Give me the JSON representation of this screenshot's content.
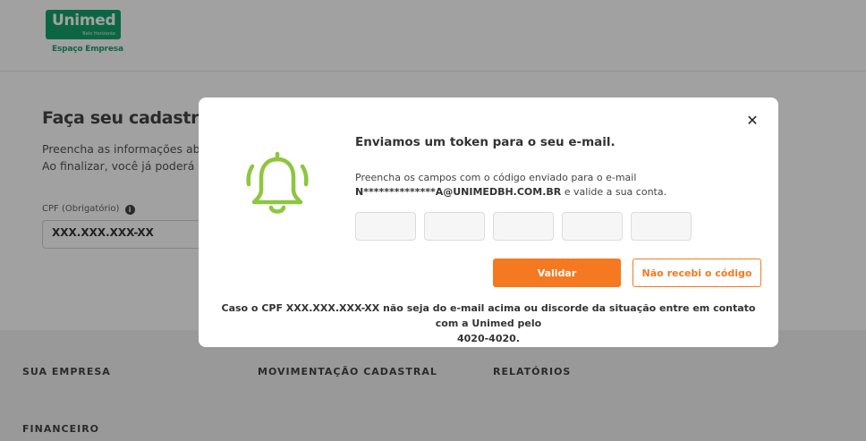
{
  "header": {
    "logo_text": "Unimed",
    "logo_subtext": "Belo Horizonte",
    "portal_name": "Espaço Empresa"
  },
  "page": {
    "title": "Faça seu cadastro",
    "description_line1": "Preencha as informações abaix",
    "description_line2": "Ao finalizar, você já poderá rea",
    "cpf_label": "CPF (Obrigatório)",
    "cpf_value": "XXX.XXX.XXX-XX"
  },
  "footer": {
    "links": [
      "SUA EMPRESA",
      "MOVIMENTAÇÃO CADASTRAL",
      "RELATÓRIOS",
      "FINANCEIRO"
    ]
  },
  "modal": {
    "title": "Enviamos um token para o seu e-mail.",
    "text_line1": "Preencha os campos com o código enviado para o e-mail",
    "email_masked": "N**************A@UNIMEDBH.COM.BR",
    "text_line2_suffix": " e valide a sua conta.",
    "validate_button": "Validar",
    "resend_button": "Não recebi o código",
    "footer_text_1": "Caso o CPF ",
    "footer_cpf": "XXX.XXX.XXX-XX",
    "footer_text_2": " não seja do e-mail acima ou discorde da situação entre em contato com a Unimed pelo",
    "footer_phone": "4020-4020."
  },
  "colors": {
    "brand_green": "#00995d",
    "accent_orange": "#f47920",
    "bell_green": "#8dc63f"
  },
  "icons": {
    "close": "close-icon",
    "bell": "bell-icon",
    "info": "info-icon"
  }
}
